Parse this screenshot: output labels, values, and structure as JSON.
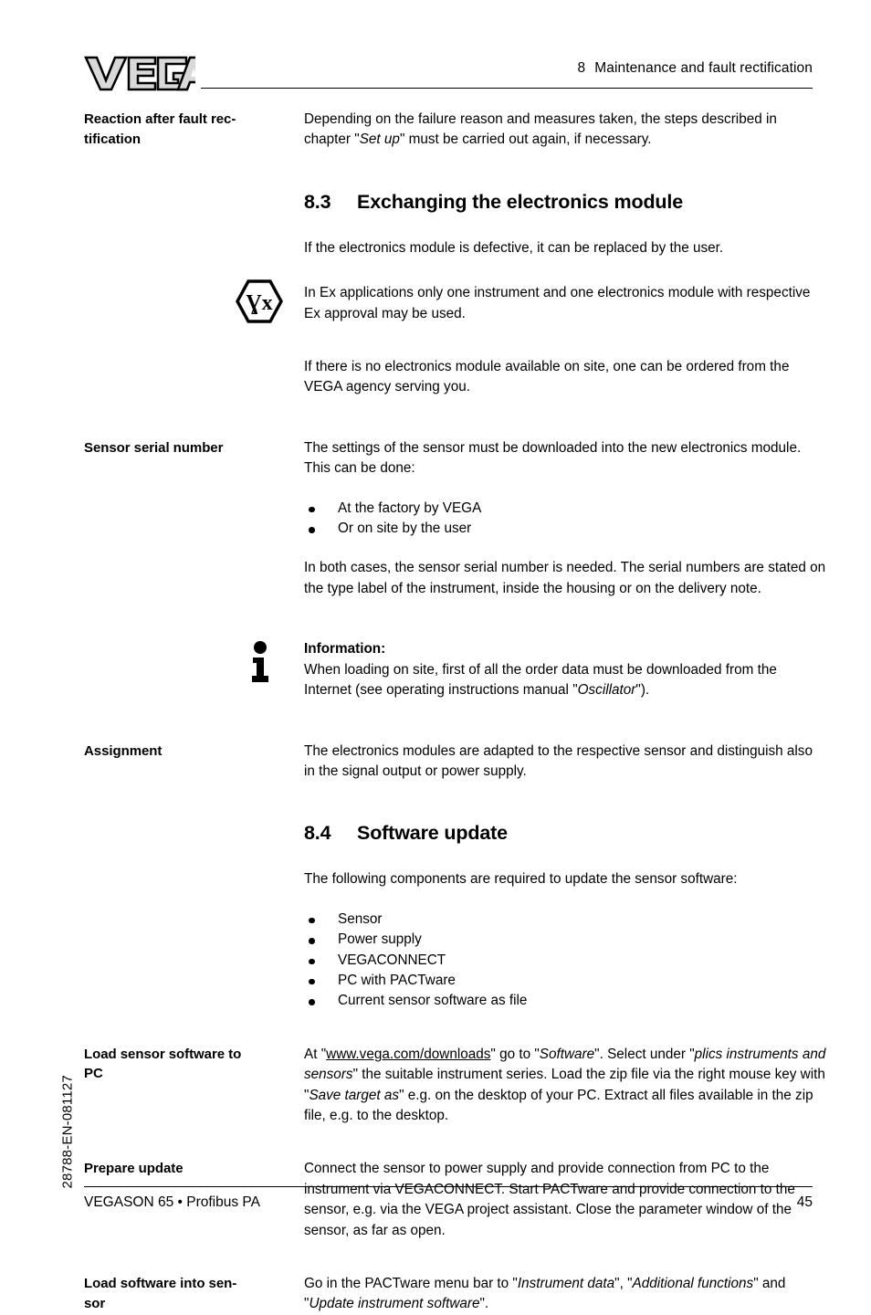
{
  "document": {
    "logo_text": "VEGA",
    "header": {
      "chapter_number": "8",
      "chapter_title": "Maintenance and fault rectification"
    },
    "footer": {
      "left": "VEGASON 65 • Profibus PA",
      "page_number": "45",
      "side_code": "28788-EN-081127"
    }
  },
  "sections": {
    "reaction": {
      "marginal_line1": "Reaction after fault rec-",
      "marginal_line2": "tification",
      "body_pre": "Depending on the failure reason and measures taken, the steps described in chapter \"",
      "body_italic": "Set up",
      "body_post": "\" must be carried out again, if necessary."
    },
    "heading_83": {
      "number": "8.3",
      "title": "Exchanging the electronics module"
    },
    "exchanging": {
      "intro": "If the electronics module is defective, it can be replaced by the user.",
      "ex_note": "In Ex applications only one instrument and one electronics module with respective Ex approval may be used.",
      "ordering": "If there is no electronics module available on site, one can be ordered from the VEGA agency serving you."
    },
    "serial": {
      "marginal": "Sensor serial number",
      "intro": "The settings of the sensor must be downloaded into the new electronics module. This can be done:",
      "bullets": [
        "At the factory by VEGA",
        "Or on site by the user"
      ],
      "outro": "In both cases, the sensor serial number is needed. The serial numbers are stated on the type label of the instrument, inside the housing or on the delivery note."
    },
    "information": {
      "title": "Information:",
      "body_pre": "When loading on site, first of all the order data must be downloaded from the Internet (see operating instructions manual \"",
      "body_italic": "Oscillator",
      "body_post": "\")."
    },
    "assignment": {
      "marginal": "Assignment",
      "body": "The electronics modules are adapted to the respective sensor and distinguish also in the signal output or power supply."
    },
    "heading_84": {
      "number": "8.4",
      "title": "Software update"
    },
    "software_update": {
      "intro": "The following components are required to update the sensor software:",
      "bullets": [
        "Sensor",
        "Power supply",
        "VEGACONNECT",
        "PC with PACTware",
        "Current sensor software as file"
      ]
    },
    "load_pc": {
      "marginal_line1": "Load sensor software to",
      "marginal_line2": "PC",
      "t1": "At \"",
      "url": "www.vega.com/downloads",
      "t2": "\" go to \"",
      "i1": "Software",
      "t3": "\". Select under \"",
      "i2": "plics instruments and sensors",
      "t4": "\" the suitable instrument series. Load the zip file via the right mouse key with \"",
      "i3": "Save target as",
      "t5": "\" e.g. on the desktop of your PC. Extract all files available in the zip file, e.g. to the desktop."
    },
    "prepare_update": {
      "marginal": "Prepare update",
      "body": "Connect the sensor to power supply and provide connection from PC to the instrument via VEGACONNECT. Start PACTware and provide connection to the sensor, e.g. via the VEGA project assistant. Close the parameter window of the sensor, as far as open."
    },
    "load_sensor": {
      "marginal_line1": "Load software into sen-",
      "marginal_line2": "sor",
      "t1": "Go in the PACTware menu bar to \"",
      "i1": "Instrument data",
      "t2": "\", \"",
      "i2": "Additional functions",
      "t3": "\" and \"",
      "i3": "Update instrument software",
      "t4": "\"."
    }
  },
  "icons": {
    "ex_symbol": "ex-hazard-icon",
    "info_symbol": "information-icon"
  },
  "colors": {
    "text": "#000000",
    "background": "#ffffff",
    "logo_fill": "#d9d9d9"
  }
}
